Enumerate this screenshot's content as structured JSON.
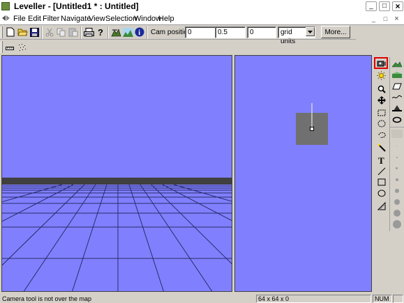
{
  "window": {
    "title": "Leveller - [Untitled1 * : Untitled]",
    "controls": {
      "minimize": "_",
      "maximize": "□",
      "close": "×"
    }
  },
  "menu": {
    "items": [
      "File",
      "Edit",
      "Filter",
      "Navigate",
      "View",
      "Selection",
      "Window",
      "Help"
    ],
    "mdi_controls": {
      "minimize": "_",
      "restore": "□",
      "close": "×"
    }
  },
  "toolbar": {
    "cam_position_label": "Cam position:",
    "cam_x": "0",
    "cam_y": "0.5",
    "cam_z": "0",
    "units_selected": "grid units",
    "more_button": "More...",
    "icons": [
      "new-icon",
      "open-icon",
      "save-icon",
      "cut-icon",
      "copy-icon",
      "paste-icon",
      "print-icon",
      "help-icon",
      "terrain-icon",
      "landscape-icon",
      "info-icon"
    ]
  },
  "secondary_toolbar": {
    "icons": [
      "ruler-icon",
      "scatter-icon"
    ]
  },
  "tool_palette": {
    "left_column": [
      "camera-tool-icon",
      "light-tool-icon",
      "zoom-tool-icon",
      "pan-tool-icon",
      "rect-select-icon",
      "ellipse-select-icon",
      "lasso-select-icon",
      "magic-wand-icon",
      "text-tool-icon",
      "line-tool-icon",
      "rectangle-tool-icon",
      "ellipse-tool-icon",
      "gradient-tool-icon"
    ],
    "right_column": [
      "raise-terrain-icon",
      "lower-terrain-icon",
      "eraser-icon",
      "smooth-icon",
      "flatten-icon",
      "erode-icon"
    ],
    "brush_sizes": [
      1,
      2,
      3,
      4,
      5,
      6,
      7,
      8,
      9
    ],
    "active_tool": "camera-tool-icon",
    "active_highlight_color": "#e00000"
  },
  "viewports": {
    "background_color": "#8080ff",
    "map_square_color": "#707070"
  },
  "statusbar": {
    "message": "Camera tool is not over the map",
    "map_size": "64 x 64 x 0",
    "num_indicator": "NUM"
  }
}
